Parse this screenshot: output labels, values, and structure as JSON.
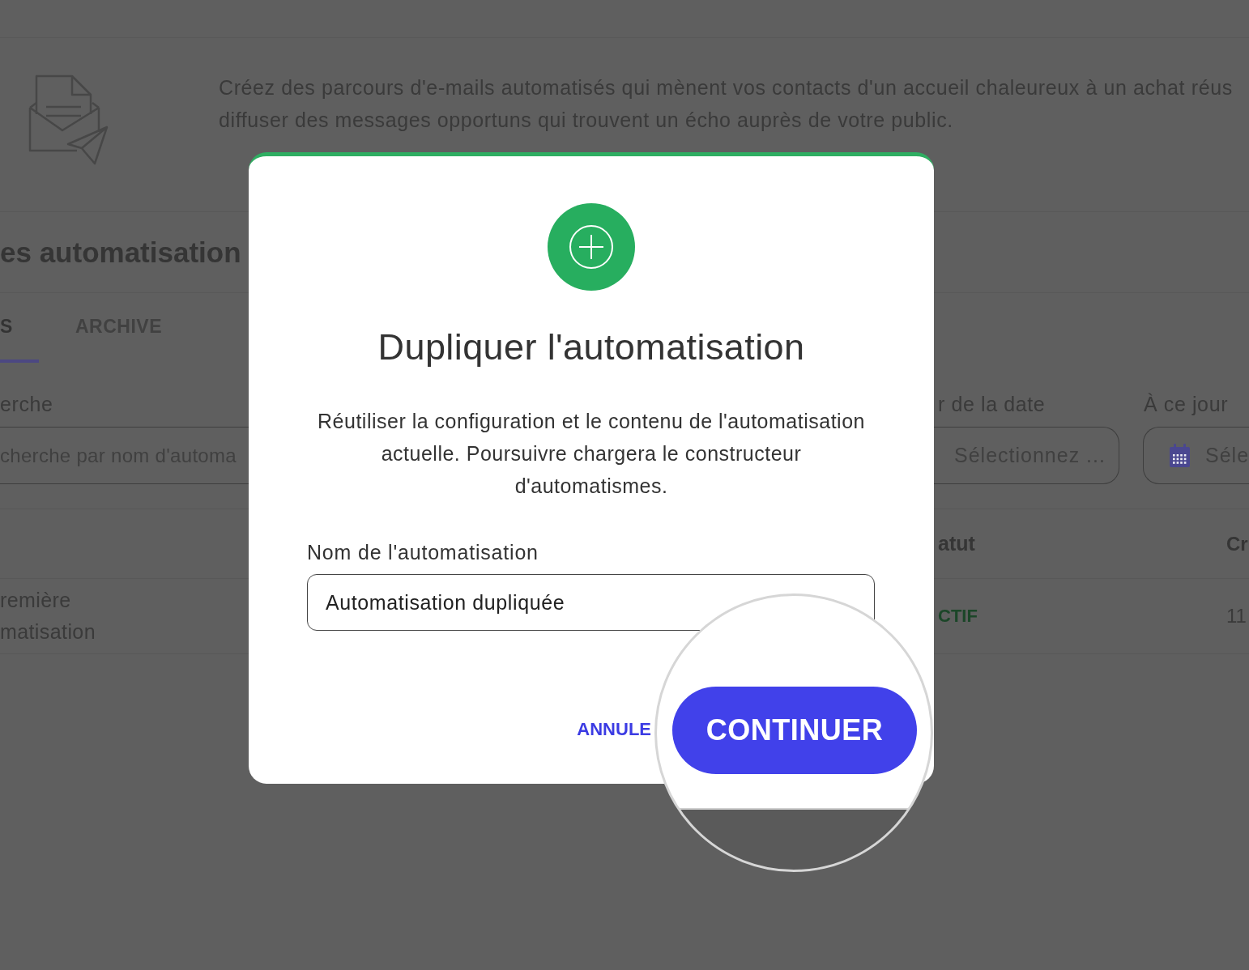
{
  "background_page": {
    "intro_lines": [
      "Créez des parcours d'e-mails automatisés qui mènent vos contacts d'un accueil chaleureux à un achat réus",
      "diffuser des messages opportuns qui trouvent un écho auprès de votre public."
    ],
    "heading": "es automatisation",
    "tabs": [
      {
        "label": "S",
        "selected": true
      },
      {
        "label": "ARCHIVE",
        "selected": false
      }
    ],
    "filters": [
      {
        "kind": "text",
        "label": "erche",
        "placeholder": "cherche par nom d'automa"
      },
      {
        "kind": "select",
        "label": "r de la date",
        "placeholder": "Sélectionnez ..."
      },
      {
        "kind": "date",
        "label": "À ce jour",
        "placeholder": "Séle"
      }
    ],
    "table": {
      "columns": [
        "atut",
        "Cr"
      ],
      "rows": [
        {
          "name_lines": [
            "remière",
            "matisation"
          ],
          "status": "CTIF",
          "created": "11"
        }
      ]
    }
  },
  "dialog": {
    "title": "Dupliquer l'automatisation",
    "description": "Réutiliser la configuration et le contenu de l'automatisation actuelle. Poursuivre chargera le constructeur d'automatismes.",
    "field": {
      "label": "Nom de l'automatisation",
      "value": "Automatisation dupliquée"
    },
    "buttons": [
      {
        "kind": "text",
        "label": "ANNULE"
      },
      {
        "kind": "primary",
        "label": "CONTINUER"
      }
    ]
  }
}
